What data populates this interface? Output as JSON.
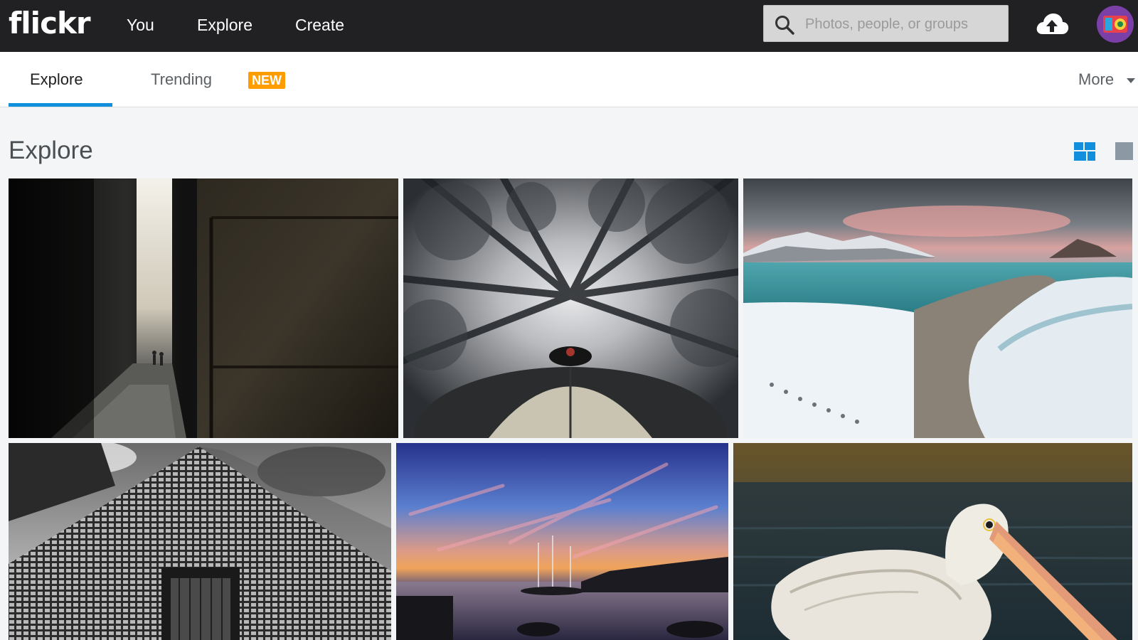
{
  "header": {
    "logo": "flickr",
    "nav": [
      {
        "label": "You"
      },
      {
        "label": "Explore"
      },
      {
        "label": "Create"
      }
    ],
    "search": {
      "placeholder": "Photos, people, or groups",
      "value": ""
    },
    "upload_icon": "cloud-upload-icon",
    "avatar_icon": "user-avatar"
  },
  "subnav": {
    "tabs": [
      {
        "label": "Explore",
        "active": true
      },
      {
        "label": "Trending",
        "active": false
      }
    ],
    "badge": "NEW",
    "more_label": "More",
    "accent_color": "#128fdc",
    "badge_color": "#ff9d00"
  },
  "main": {
    "title": "Explore",
    "view_toggles": [
      "justified-view-icon",
      "single-view-icon"
    ],
    "photos": [
      {
        "subject": "dark alley with stone wall"
      },
      {
        "subject": "looking up through snowy forest canopy"
      },
      {
        "subject": "snowy beach with mountains at dusk"
      },
      {
        "subject": "black and white skyscraper facade"
      },
      {
        "subject": "harbor sunset with sailboats"
      },
      {
        "subject": "white pelican on water"
      }
    ]
  },
  "colors": {
    "header_bg": "#212124",
    "page_bg": "#f3f5f6"
  }
}
